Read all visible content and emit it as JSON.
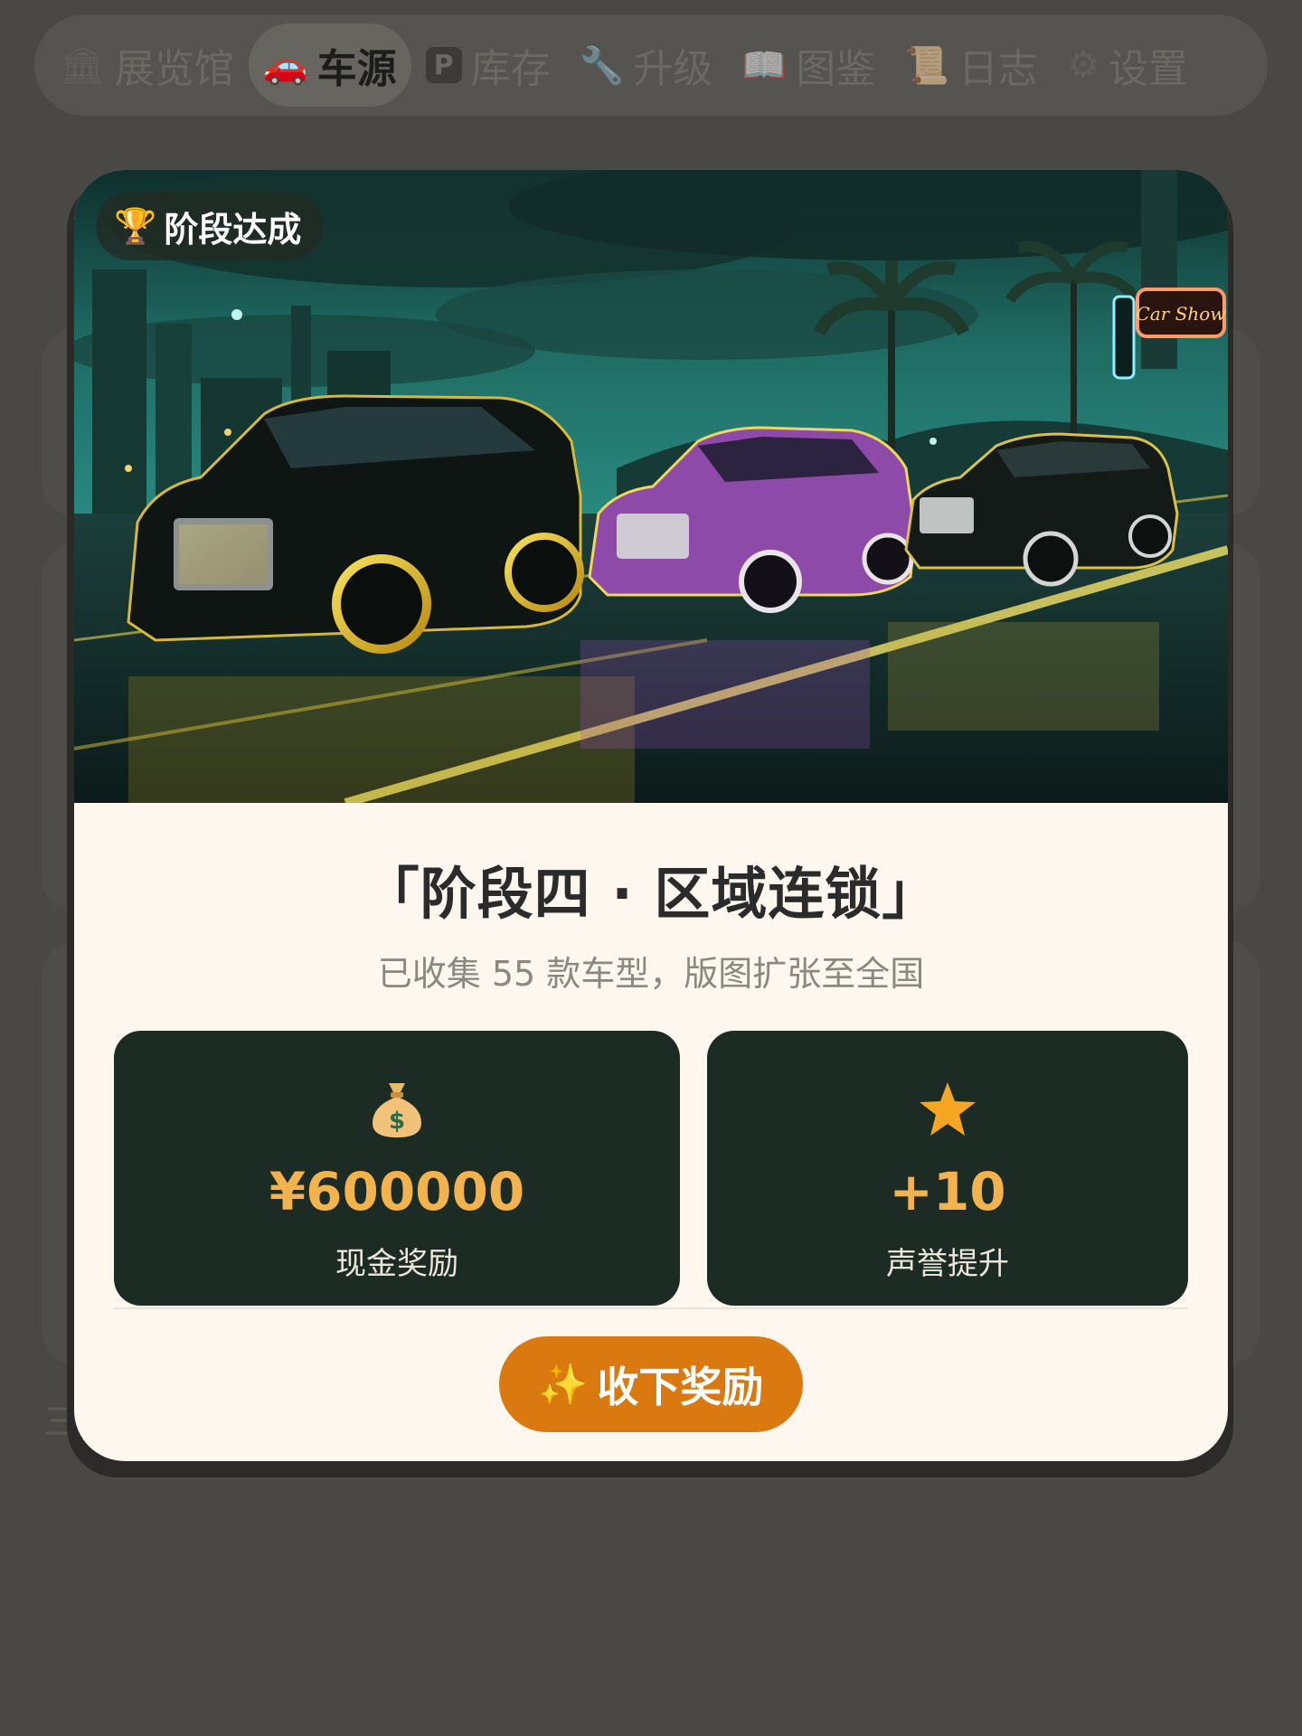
{
  "nav": {
    "items": [
      {
        "icon": "museum-icon",
        "glyph": "🏛",
        "label": "展览馆",
        "active": false
      },
      {
        "icon": "car-icon",
        "glyph": "🚗",
        "label": "车源",
        "active": true
      },
      {
        "icon": "parking-icon",
        "glyph": "P",
        "label": "库存",
        "active": false
      },
      {
        "icon": "wrench-icon",
        "glyph": "🔧",
        "label": "升级",
        "active": false
      },
      {
        "icon": "book-icon",
        "glyph": "📖",
        "label": "图鉴",
        "active": false
      },
      {
        "icon": "scroll-icon",
        "glyph": "📜",
        "label": "日志",
        "active": false
      },
      {
        "icon": "gear-icon",
        "glyph": "⚙",
        "label": "设置",
        "active": false
      }
    ]
  },
  "background": {
    "fragment_text": "三"
  },
  "modal": {
    "badge": {
      "icon": "trophy-icon",
      "glyph": "🏆",
      "label": "阶段达成"
    },
    "hero_sign": "Car Show",
    "title": "「阶段四 · 区域连锁」",
    "subtitle": "已收集 55 款车型，版图扩张至全国",
    "rewards": {
      "cash": {
        "icon": "money-bag-icon",
        "value": "¥600000",
        "label": "现金奖励"
      },
      "reputation": {
        "icon": "star-icon",
        "value": "+10",
        "label": "声誉提升"
      }
    },
    "claim_button": {
      "icon": "sparkle-icon",
      "glyph": "✨",
      "label": "收下奖励"
    }
  },
  "colors": {
    "overlay": "#4a4844",
    "modal_bg": "#fdf7ef",
    "reward_card": "#1c2b23",
    "reward_value": "#f2b24e",
    "button": "#d9790f"
  }
}
